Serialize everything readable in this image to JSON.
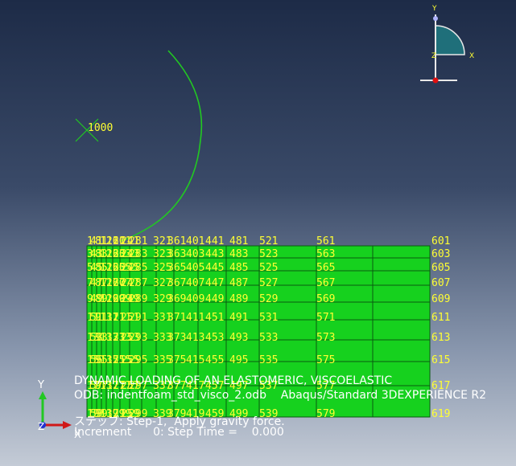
{
  "viewport": {
    "bg_top": "#1d2b47",
    "bg_bottom": "#c4cbd6",
    "mesh_fill": "#16d11e",
    "mesh_line": "#0a5a10",
    "label_color": "#ffff33",
    "indenter_color": "#22c822"
  },
  "reference_point_label": "1000",
  "triad": {
    "x": "X",
    "y": "Y",
    "z": "Z"
  },
  "view_triad": {
    "x": "X",
    "y": "Y",
    "z": "Z"
  },
  "node_labels": {
    "right_column": [
      "601",
      "603",
      "605",
      "607",
      "609",
      "611",
      "613",
      "615",
      "617",
      "619"
    ],
    "top_row": [
      "1",
      "41",
      "81",
      "121",
      "161",
      "201",
      "241",
      "281",
      "321",
      "361",
      "401",
      "441",
      "481",
      "521",
      "561"
    ],
    "row_603": [
      "3",
      "43",
      "83",
      "123",
      "163",
      "203",
      "243",
      "283",
      "323",
      "363",
      "403",
      "443",
      "483",
      "523",
      "563"
    ],
    "row_605": [
      "5",
      "45",
      "85",
      "125",
      "165",
      "205",
      "245",
      "285",
      "325",
      "365",
      "405",
      "445",
      "485",
      "525",
      "565"
    ],
    "row_607": [
      "7",
      "47",
      "87",
      "127",
      "167",
      "207",
      "247",
      "287",
      "327",
      "367",
      "407",
      "447",
      "487",
      "527",
      "567"
    ],
    "row_609": [
      "9",
      "49",
      "89",
      "129",
      "169",
      "209",
      "249",
      "289",
      "329",
      "369",
      "409",
      "449",
      "489",
      "529",
      "569"
    ],
    "row_611": [
      "11",
      "51",
      "91",
      "131",
      "171",
      "211",
      "251",
      "291",
      "331",
      "371",
      "411",
      "451",
      "491",
      "531",
      "571"
    ],
    "row_613": [
      "13",
      "53",
      "93",
      "133",
      "173",
      "213",
      "253",
      "293",
      "333",
      "373",
      "413",
      "453",
      "493",
      "533",
      "573"
    ],
    "row_615": [
      "15",
      "55",
      "95",
      "135",
      "175",
      "215",
      "255",
      "295",
      "335",
      "375",
      "415",
      "455",
      "495",
      "535",
      "575"
    ],
    "row_617": [
      "17",
      "57",
      "97",
      "137",
      "177",
      "217",
      "257",
      "297",
      "337",
      "377",
      "417",
      "457",
      "497",
      "537",
      "577"
    ],
    "row_619": [
      "19",
      "59",
      "99",
      "139",
      "179",
      "219",
      "259",
      "299",
      "339",
      "379",
      "419",
      "459",
      "499",
      "539",
      "579"
    ]
  },
  "info": {
    "title": "DYNAMIC LOADING OF AN ELASTOMERIC, VISCOELASTIC",
    "odb": "ODB: indentfoam_std_visco_2.odb    Abaqus/Standard 3DEXPERIENCE R2",
    "step": "ステップ: Step-1,  Apply gravity force.",
    "increment": "Increment      0: Step Time =    0.000"
  }
}
